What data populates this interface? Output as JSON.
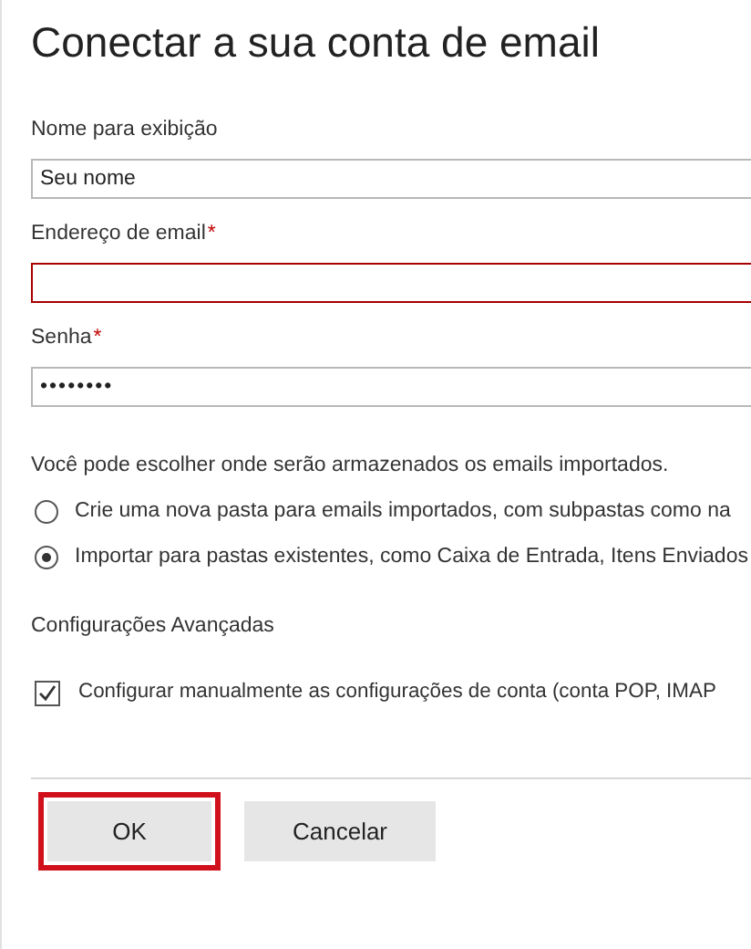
{
  "title": "Conectar a sua conta de email",
  "fields": [
    {
      "label": "Nome para exibição",
      "value": "Seu nome",
      "kind": "text",
      "error": false
    },
    {
      "label": "Endereço de email",
      "required_mark": "*",
      "kind": "text",
      "error": true
    },
    {
      "label": "Senha",
      "required_mark": "*",
      "value": "••••••••",
      "kind": "password",
      "error": false
    }
  ],
  "import_prompt": "Você pode escolher onde serão armazenados os emails importados.",
  "import_options": [
    {
      "label": "Crie uma nova pasta para emails importados, com subpastas como na",
      "selected": false
    },
    {
      "label": "Importar para pastas existentes, como Caixa de Entrada, Itens Enviados",
      "selected": true
    }
  ],
  "advanced": {
    "heading": "Configurações Avançadas",
    "checkbox": {
      "label": "Configurar manualmente as configurações de conta (conta POP, IMAP",
      "checked": true
    }
  },
  "buttons": [
    {
      "label": "OK",
      "highlighted": true
    },
    {
      "label": "Cancelar",
      "highlighted": false
    }
  ]
}
